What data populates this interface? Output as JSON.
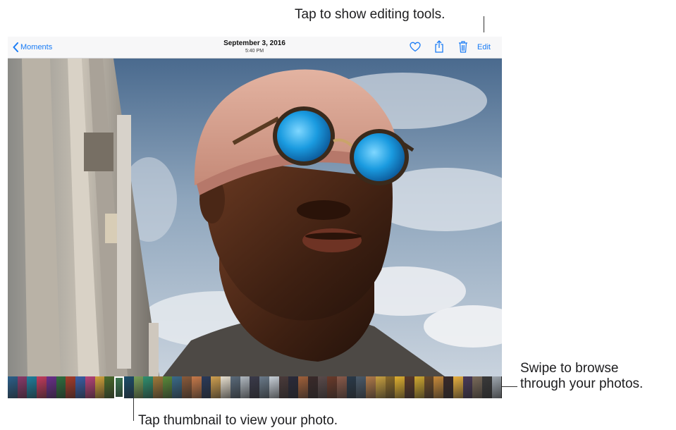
{
  "callouts": {
    "top": "Tap to show editing tools.",
    "right_line1": "Swipe to browse",
    "right_line2": "through your photos.",
    "bottom": "Tap thumbnail to view your photo."
  },
  "navbar": {
    "back_label": "Moments",
    "date": "September 3, 2016",
    "time": "5:40 PM",
    "edit_label": "Edit",
    "icons": [
      "chevron-left-icon",
      "heart-icon",
      "share-icon",
      "trash-icon"
    ]
  },
  "colors": {
    "accent": "#1a7cf5"
  },
  "filmstrip": {
    "selected_index": 11,
    "thumbs": [
      "#2b5f8a",
      "#8a3a6b",
      "#1f7f9e",
      "#c33b5e",
      "#6a2f8c",
      "#2f6f3f",
      "#a83c2a",
      "#3a5fa8",
      "#b8437a",
      "#d2a23a",
      "#4a6a2b",
      "#3d7a52",
      "#1c4d6b",
      "#7aa05a",
      "#2f8f6f",
      "#a07a3a",
      "#5a8a3a",
      "#3a6a8a",
      "#8a5a3a",
      "#c87a4a",
      "#2a3a5a",
      "#d0a050",
      "#e8e0d0",
      "#5a6a7a",
      "#b0b8c0",
      "#3a3a4a",
      "#6a7a8a",
      "#c8d0d8",
      "#4a3a3a",
      "#2a2a3a",
      "#a0603a",
      "#3a2a2a",
      "#5a4a4a",
      "#6a3a2a",
      "#8a5a4a",
      "#2a3a4a",
      "#4a5a6a",
      "#b07a4a",
      "#c8a040",
      "#8a6a2a",
      "#e0b030",
      "#5a3a2a",
      "#d0a830",
      "#6a4a2a",
      "#c88a3a",
      "#3a2a2a",
      "#e8b040",
      "#4a3a5a",
      "#7a6a5a",
      "#3a3a3a",
      "#a0a8b0"
    ]
  }
}
